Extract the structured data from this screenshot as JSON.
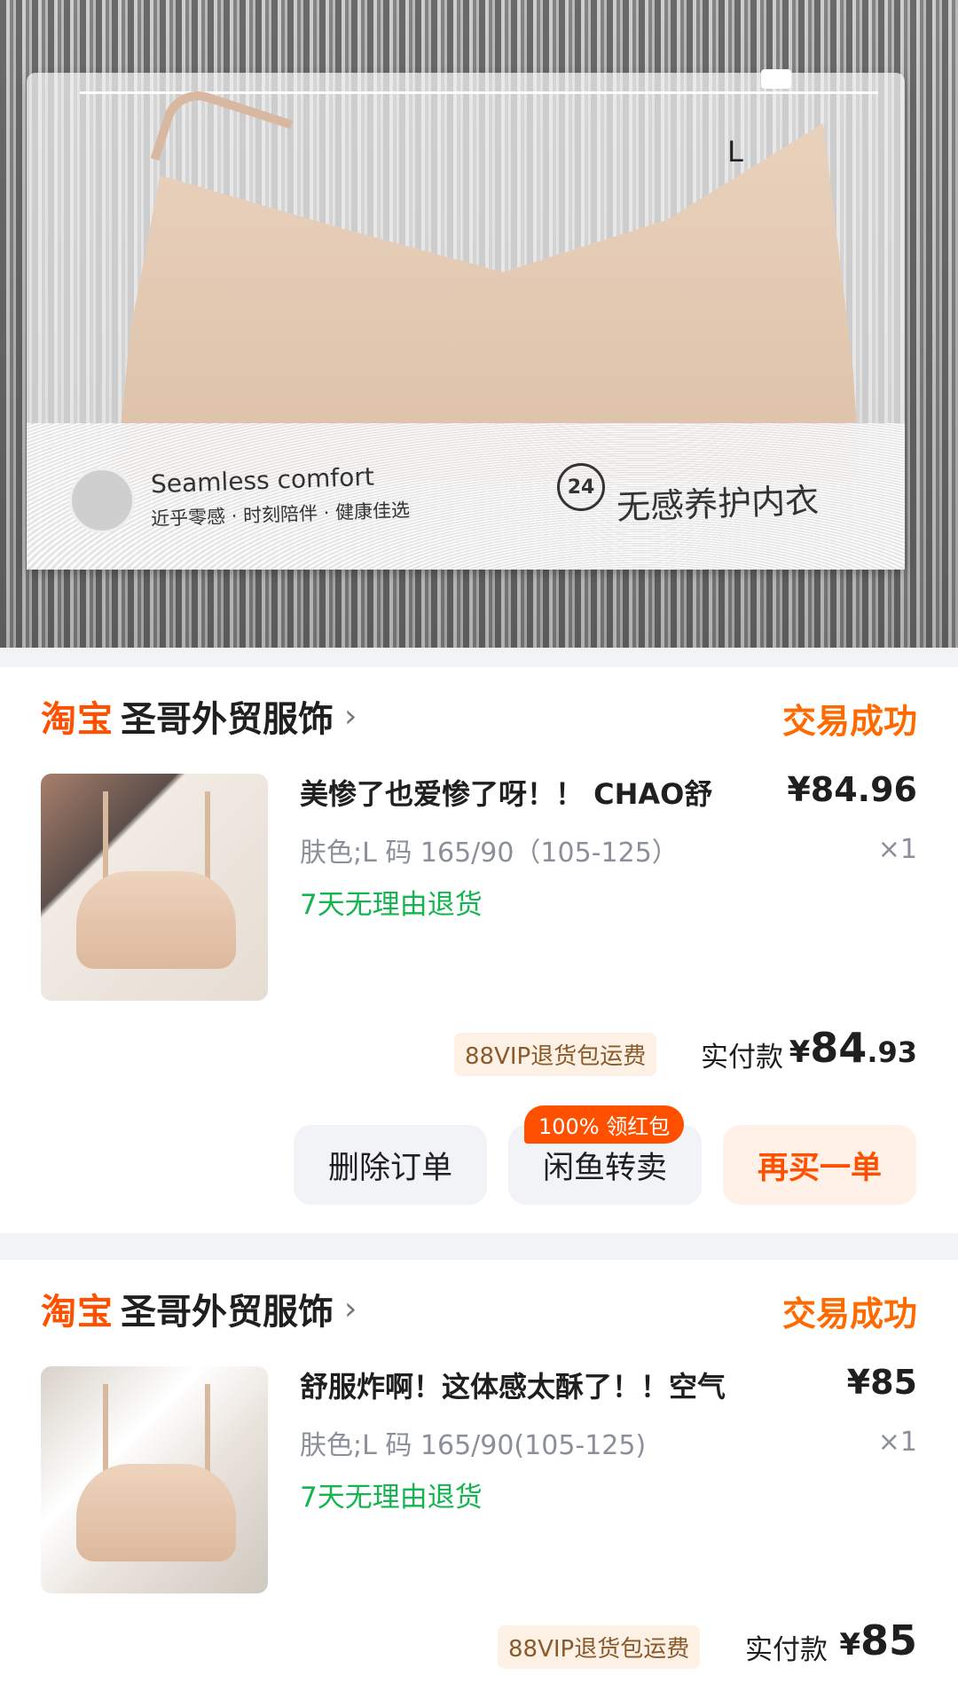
{
  "hero": {
    "label_size": "L",
    "band_en": "Seamless comfort",
    "band_cn": "近乎零感 · 时刻陪伴 · 健康佳选",
    "band_24": "24",
    "band_title": "无感养护内衣"
  },
  "orders": [
    {
      "platform": "淘宝",
      "shop_name": "圣哥外贸服饰",
      "status": "交易成功",
      "title": "美惨了也爱惨了呀！！ CHAO舒",
      "price": "¥84.96",
      "sku": "肤色;L 码 165/90（105-125）",
      "quantity": "×1",
      "refund_policy": "7天无理由退货",
      "vip_tag": "88VIP退货包运费",
      "pay_label": "实付款",
      "pay_currency": "¥",
      "pay_integer": "84",
      "pay_decimal": ".93",
      "buttons": {
        "delete": "删除订单",
        "resell": "闲鱼转卖",
        "rebuy": "再买一单"
      },
      "resell_badge": "100% 领红包"
    },
    {
      "platform": "淘宝",
      "shop_name": "圣哥外贸服饰",
      "status": "交易成功",
      "title": "舒服炸啊！这体感太酥了！！空气",
      "price": "¥85",
      "sku": "肤色;L 码 165/90(105-125)",
      "quantity": "×1",
      "refund_policy": "7天无理由退货",
      "vip_tag": "88VIP退货包运费",
      "pay_label": "实付款",
      "pay_currency": "¥",
      "pay_integer": "85"
    }
  ],
  "colors": {
    "taobao_orange": "#ff5000",
    "status_orange": "#ff6a00",
    "refund_green": "#14b550"
  }
}
